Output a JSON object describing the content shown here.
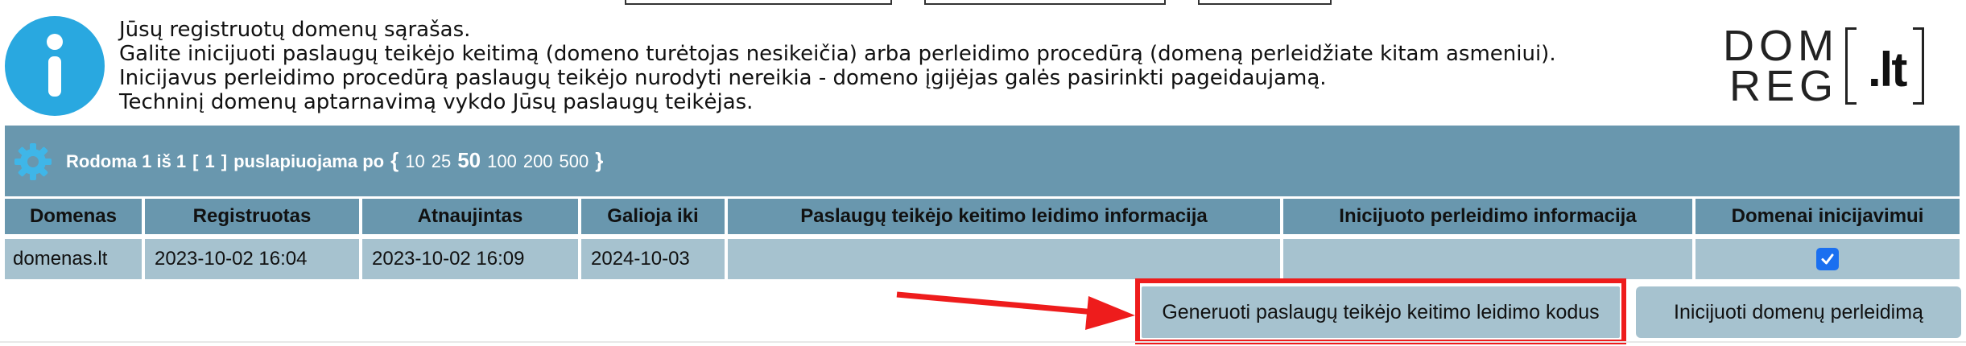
{
  "info": {
    "lines": [
      "Jūsų registruotų domenų sąrašas.",
      "Galite inicijuoti paslaugų teikėjo keitimą (domeno turėtojas nesikeičia) arba perleidimo procedūrą (domeną perleidžiate kitam asmeniui).",
      "Inicijavus perleidimo procedūrą paslaugų teikėjo nurodyti nereikia - domeno įgijėjas galės pasirinkti pageidaujamą.",
      "Techninį domenų aptarnavimą vykdo Jūsų paslaugų teikėjas."
    ]
  },
  "logo": {
    "line1": "DOM",
    "line2": "REG",
    "tld": ".lt"
  },
  "toolbar": {
    "showing_label": "Rodoma 1 iš 1",
    "page_open": "[",
    "page": "1",
    "page_close": "]",
    "per_page_label": "puslapiuojama po",
    "brace_open": "{",
    "brace_close": "}",
    "page_sizes": [
      "10",
      "25",
      "50",
      "100",
      "200",
      "500"
    ],
    "active_page_size": "50"
  },
  "table": {
    "headers": [
      "Domenas",
      "Registruotas",
      "Atnaujintas",
      "Galioja iki",
      "Paslaugų teikėjo keitimo leidimo informacija",
      "Inicijuoto perleidimo informacija",
      "Domenai inicijavimui"
    ],
    "rows": [
      {
        "domain": "domenas.lt",
        "registered": "2023-10-02 16:04",
        "updated": "2023-10-02 16:09",
        "valid_until": "2024-10-03",
        "provider_change_info": "",
        "transfer_info": "",
        "selected": true
      }
    ]
  },
  "buttons": {
    "generate_codes": "Generuoti paslaugų teikėjo keitimo leidimo kodus",
    "initiate_transfer": "Inicijuoti domenų perleidimą"
  },
  "colors": {
    "header_blue": "#6997ae",
    "cell_blue": "#a6c2cf",
    "info_blue": "#29a8e0",
    "highlight_red": "#ee1c1c",
    "checkbox_blue": "#1a6ff0"
  }
}
